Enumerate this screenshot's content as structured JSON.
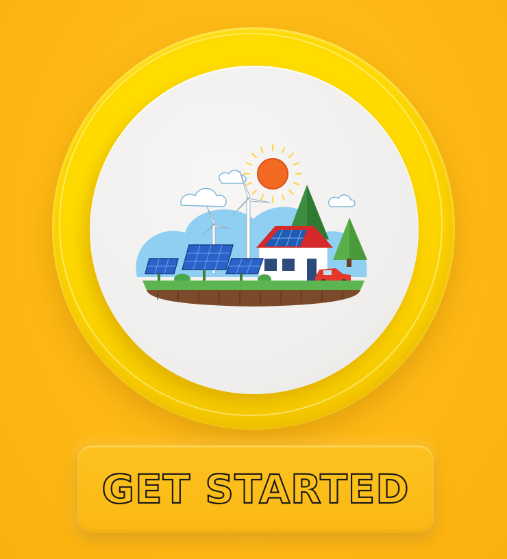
{
  "button": {
    "label": "GET STARTED"
  },
  "illustration": {
    "icon": "renewable-energy-house-illustration"
  },
  "colors": {
    "background": "#FDB813",
    "ring": "#FFDA00",
    "disc": "#EFEEEC",
    "button": "#FDC21E",
    "button_text_outline": "#1A1A1A"
  }
}
